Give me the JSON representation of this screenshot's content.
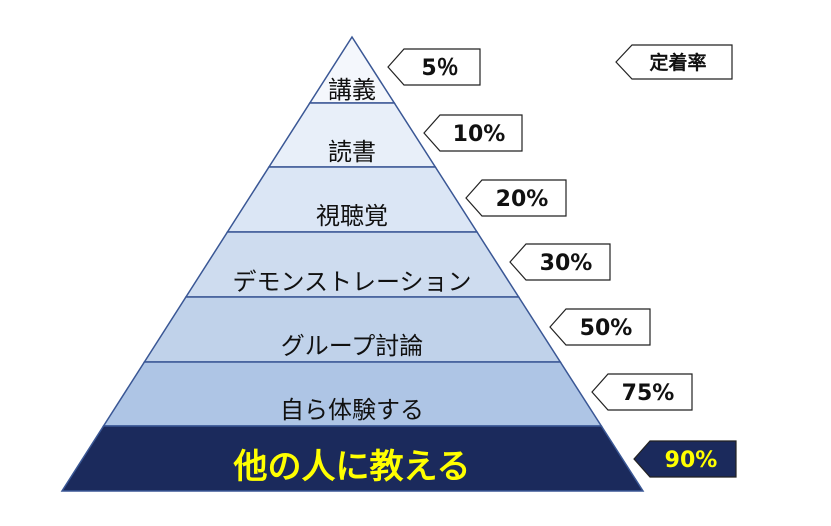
{
  "header": {
    "label": "定着率"
  },
  "levels": [
    {
      "label": "講義",
      "rate": "5％"
    },
    {
      "label": "読書",
      "rate": "10%"
    },
    {
      "label": "視聴覚",
      "rate": "20%"
    },
    {
      "label": "デモンストレーション",
      "rate": "30%"
    },
    {
      "label": "グループ討論",
      "rate": "50%"
    },
    {
      "label": "自ら体験する",
      "rate": "75%"
    },
    {
      "label": "他の人に教える",
      "rate": "90%"
    }
  ],
  "colors": {
    "outline": "#3a5795",
    "level_fills": [
      "#f4f7fc",
      "#e8eff9",
      "#dbe6f5",
      "#cedcef",
      "#c0d2ea",
      "#aec5e5",
      "#1b2a5c"
    ],
    "highlight_text": "#ffff00",
    "highlight_tag_fill": "#1b2a5c"
  }
}
